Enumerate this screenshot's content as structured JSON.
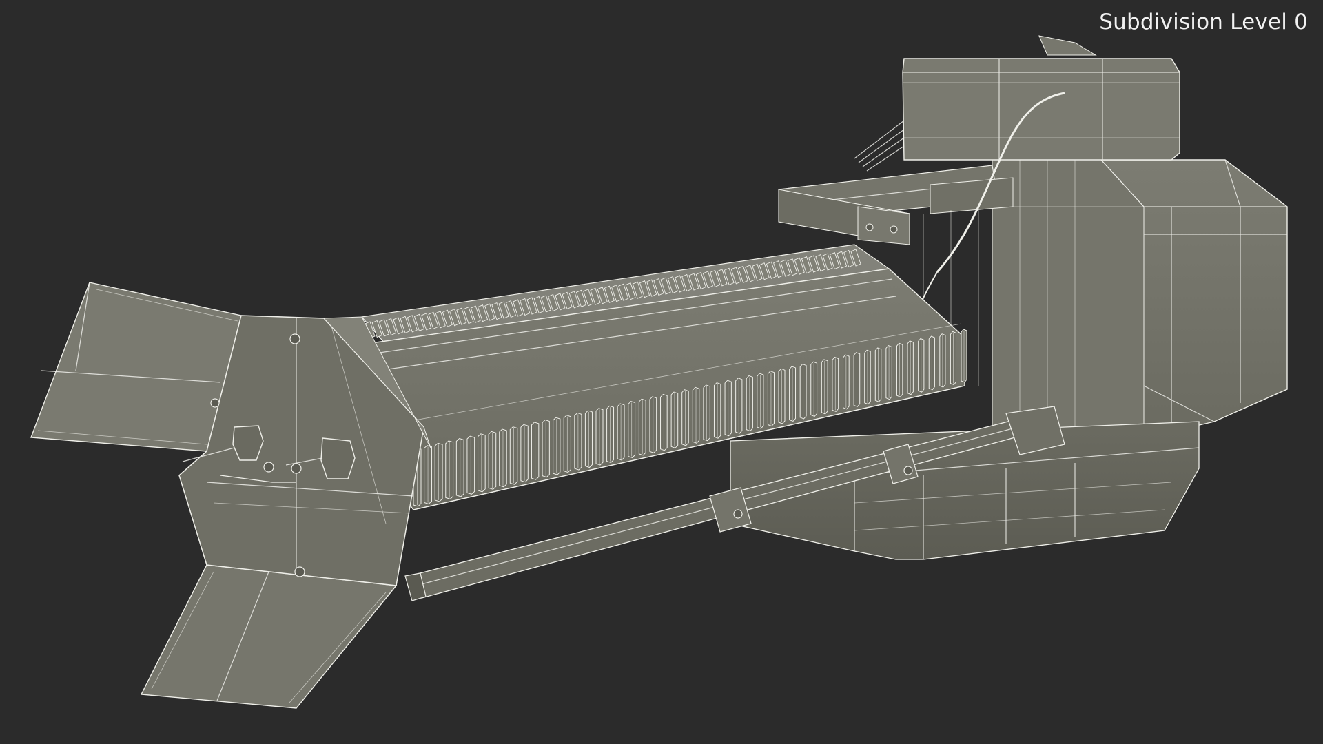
{
  "viewport": {
    "label": "Subdivision Level 0",
    "background": "#2b2b2b",
    "model_color": "#77776d",
    "wire_color": "#eeeee8"
  }
}
